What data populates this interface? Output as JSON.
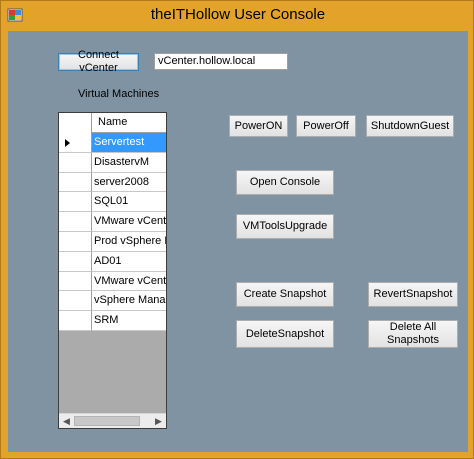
{
  "window": {
    "title": "theITHollow User Console"
  },
  "connect": {
    "button_label": "Connect vCenter",
    "server_value": "vCenter.hollow.local"
  },
  "vm_section": {
    "label": "Virtual Machines"
  },
  "grid": {
    "column_header": "Name",
    "rows": [
      "Servertest",
      "DisastervM",
      "server2008",
      "SQL01",
      "VMware vCenter ...",
      "Prod vSphere Re...",
      "AD01",
      "VMware vCenter ...",
      "vSphere Manage...",
      "SRM"
    ],
    "selected_row": "Servertest"
  },
  "actions": {
    "power_on": "PowerON",
    "power_off": "PowerOff",
    "shutdown_guest": "ShutdownGuest",
    "open_console": "Open Console",
    "vmtools_upgrade": "VMToolsUpgrade",
    "create_snapshot": "Create Snapshot",
    "revert_snapshot": "RevertSnapshot",
    "delete_snapshot": "DeleteSnapshot",
    "delete_all_snapshots": "Delete All\nSnapshots"
  },
  "colors": {
    "window_frame": "#e3a32a",
    "client_background": "#7f93a2",
    "selection": "#3399ff"
  }
}
